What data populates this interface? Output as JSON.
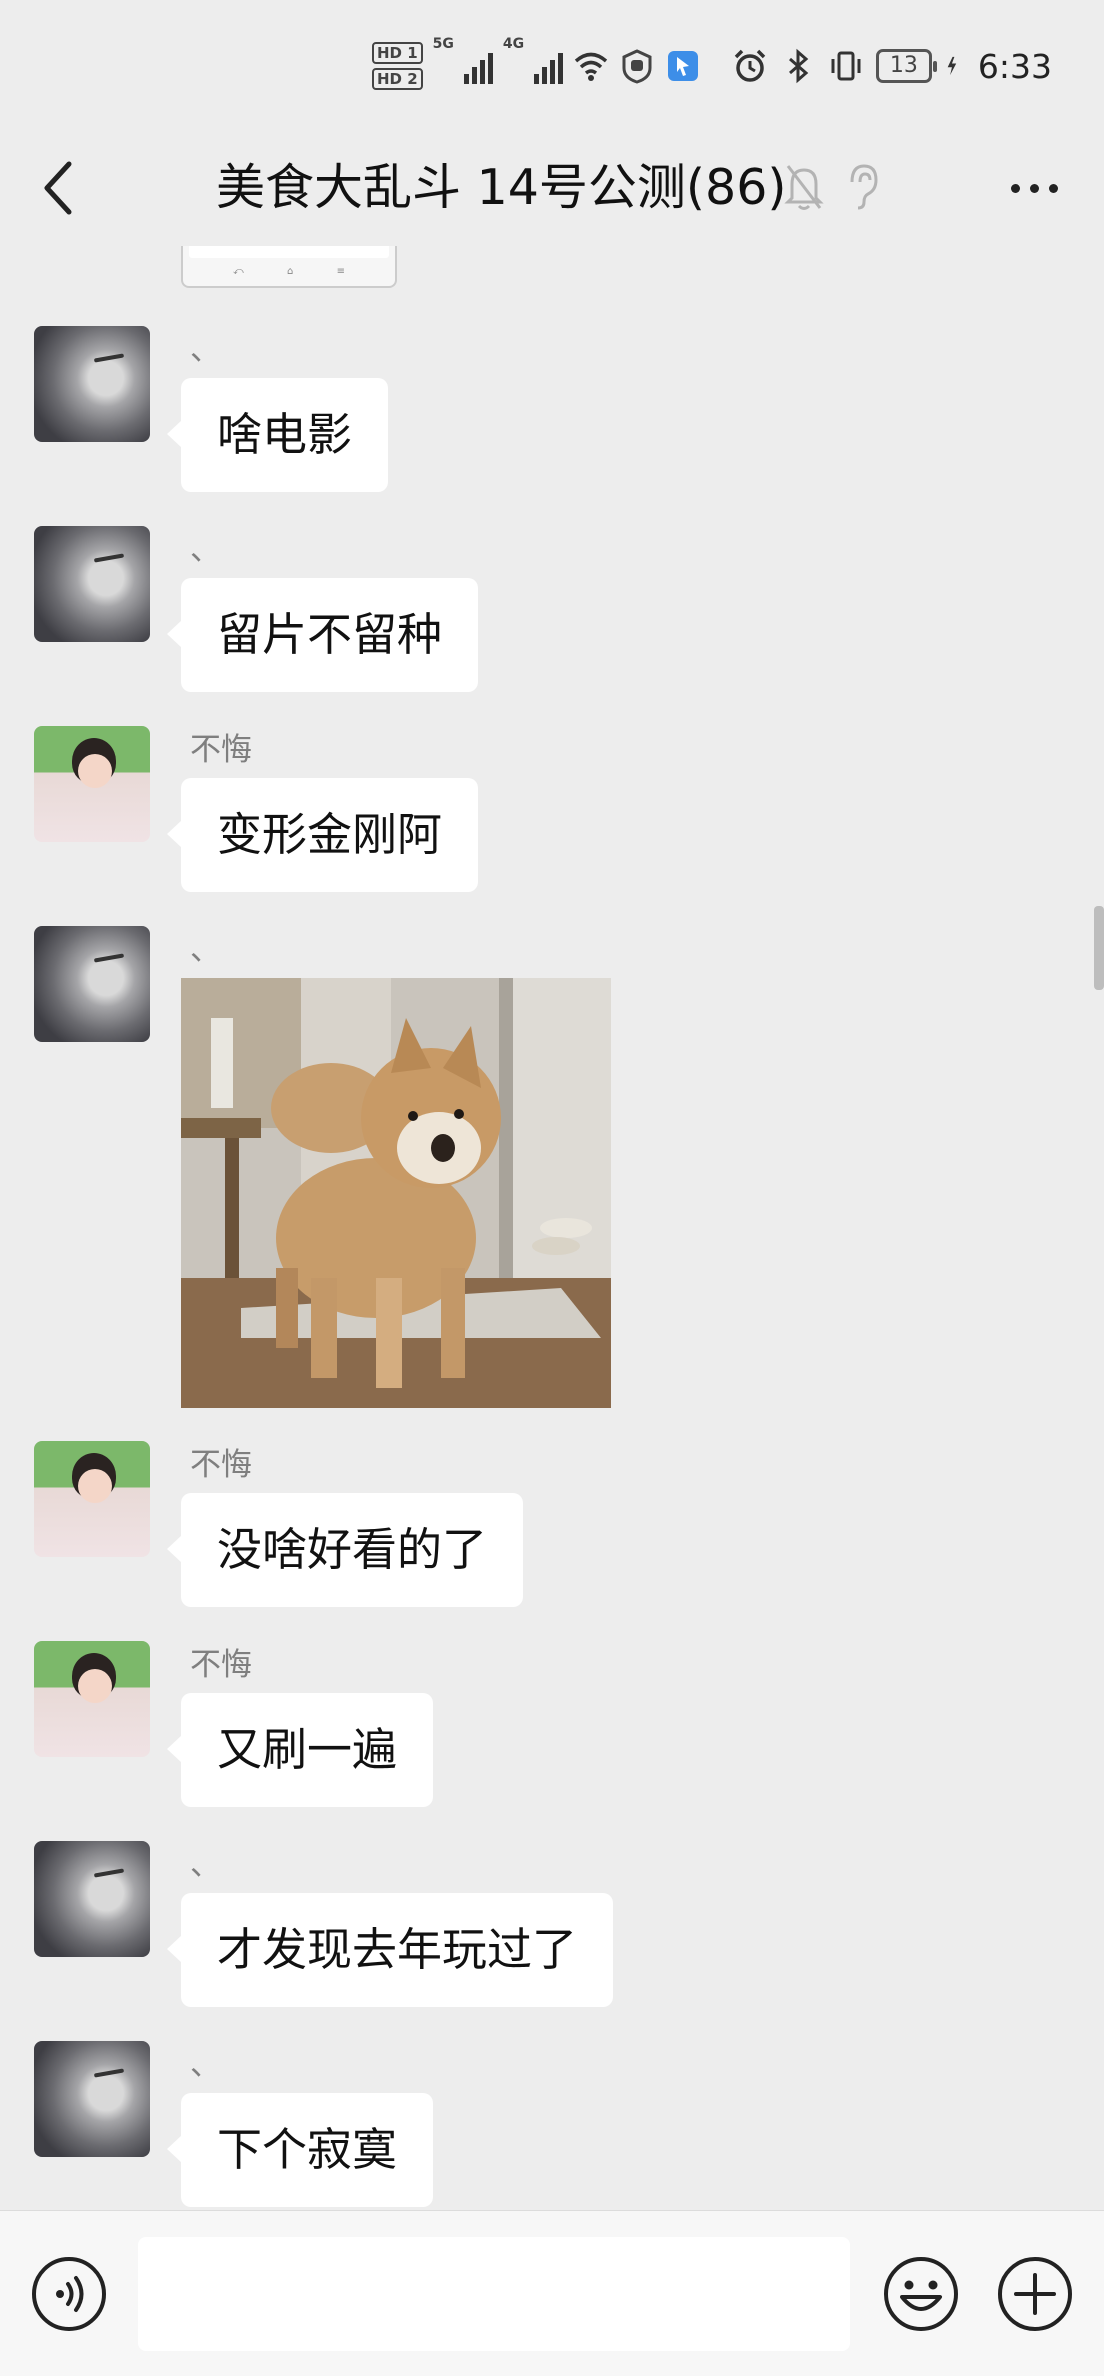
{
  "status_bar": {
    "hd1": "HD 1",
    "hd2": "HD 2",
    "sig1_label": "5G",
    "sig2_label": "4G",
    "battery": "13",
    "time": "6:33"
  },
  "nav": {
    "title": "美食大乱斗 14号公测(86)",
    "back_icon": "chevron-left-icon",
    "mute_icon": "bell-off-icon",
    "ear_icon": "ear-icon",
    "more_icon": "more-dots-icon"
  },
  "messages": [
    {
      "sender": "、",
      "avatar": "cat",
      "text": "啥电影"
    },
    {
      "sender": "、",
      "avatar": "cat",
      "text": "留片不留种"
    },
    {
      "sender": "不悔",
      "avatar": "boy",
      "text": "变形金刚阿"
    },
    {
      "sender": "、",
      "avatar": "cat",
      "image": "shiba-dog-photo"
    },
    {
      "sender": "不悔",
      "avatar": "boy",
      "text": "没啥好看的了"
    },
    {
      "sender": "不悔",
      "avatar": "boy",
      "text": "又刷一遍"
    },
    {
      "sender": "、",
      "avatar": "cat",
      "text": "才发现去年玩过了"
    },
    {
      "sender": "、",
      "avatar": "cat",
      "text": "下个寂寞"
    }
  ],
  "input_bar": {
    "voice_icon": "voice-icon",
    "emoji_icon": "emoji-icon",
    "plus_icon": "plus-circle-icon",
    "placeholder": ""
  },
  "colors": {
    "background": "#ededed",
    "bubble": "#ffffff",
    "sender_name": "#7f7f7f",
    "input_bar": "#f7f7f7"
  }
}
